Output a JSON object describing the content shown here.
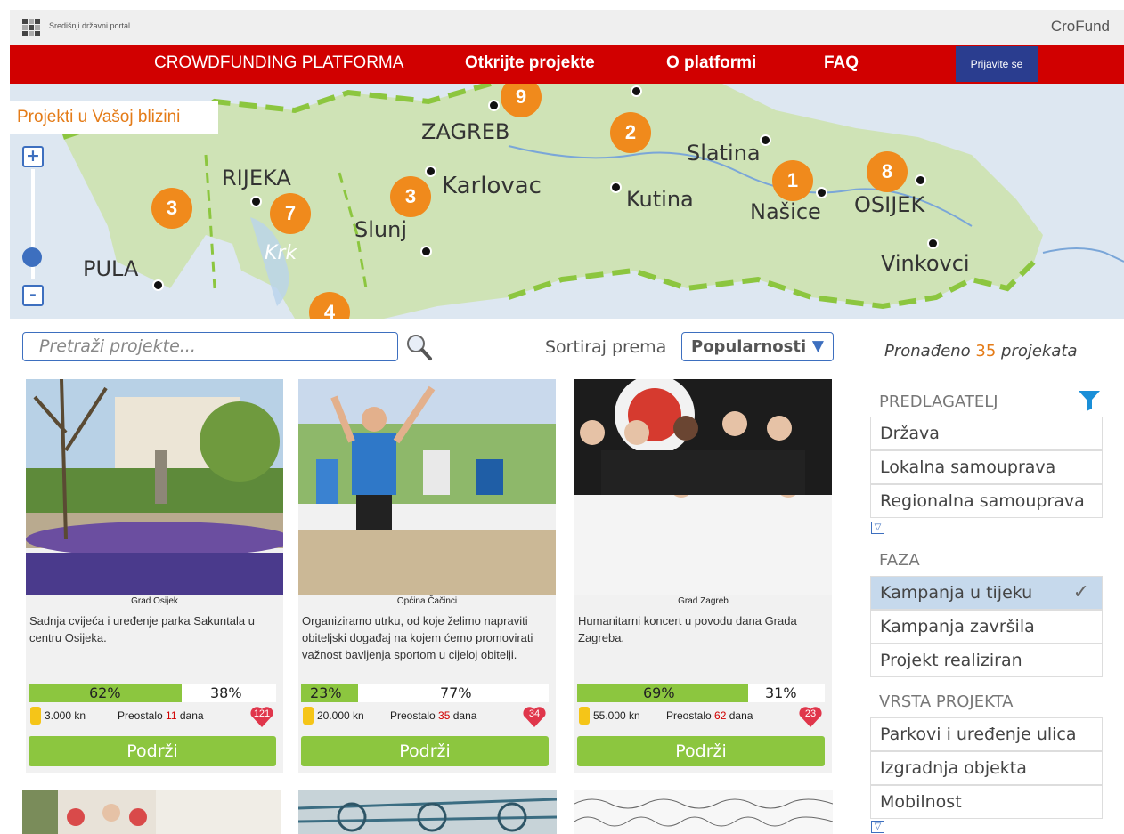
{
  "header": {
    "gov_portal": "Središnji državni portal",
    "brand": "CroFund"
  },
  "nav": {
    "platform": "CROWDFUNDING PLATFORMA",
    "discover": "Otkrijte projekte",
    "about": "O platformi",
    "faq": "FAQ",
    "login": "Prijavite se"
  },
  "map": {
    "title": "Projekti u Vašoj blizini",
    "zoom_in": "+",
    "zoom_out": "-",
    "zoom_level_fraction": 0.65,
    "cities": [
      "ZAGREB",
      "Karlovac",
      "Kutina",
      "Slatina",
      "Našice",
      "OSIJEK",
      "RIJEKA",
      "Slunj",
      "Vinkovci",
      "PULA",
      "Krk"
    ],
    "markers": [
      "9",
      "2",
      "1",
      "8",
      "3",
      "7",
      "3",
      "4"
    ]
  },
  "search": {
    "placeholder": "Pretraži projekte...",
    "sort_label": "Sortiraj prema",
    "sort_value": "Popularnosti"
  },
  "cards": [
    {
      "org": "Grad Osijek",
      "desc": "Sadnja cvijeća i uređenje parka Sakuntala u centru Osijeka.",
      "funded_pct": "62%",
      "remaining_pct": "38%",
      "funded_fraction": 0.62,
      "goal": "3.000 kn",
      "remain_prefix": "Preostalo",
      "days": "11",
      "remain_suffix": "dana",
      "likes": "121",
      "button": "Podrži"
    },
    {
      "org": "Općina Čačinci",
      "desc": "Organiziramo utrku, od koje želimo napraviti obiteljski događaj na kojem ćemo promovirati važnost bavljenja sportom u cijeloj obitelji.",
      "funded_pct": "23%",
      "remaining_pct": "77%",
      "funded_fraction": 0.23,
      "goal": "20.000 kn",
      "remain_prefix": "Preostalo",
      "days": "35",
      "remain_suffix": "dana",
      "likes": "34",
      "button": "Podrži"
    },
    {
      "org": "Grad Zagreb",
      "desc": "Humanitarni koncert u povodu dana Grada Zagreba.",
      "funded_pct": "69%",
      "remaining_pct": "31%",
      "funded_fraction": 0.69,
      "goal": "55.000 kn",
      "remain_prefix": "Preostalo",
      "days": "62",
      "remain_suffix": "dana",
      "likes": "23",
      "button": "Podrži"
    }
  ],
  "results": {
    "prefix": "Pronađeno",
    "count": "35",
    "suffix": "projekata"
  },
  "filters": {
    "proposer": {
      "title": "PREDLAGATELJ",
      "items": [
        "Država",
        "Lokalna samouprava",
        "Regionalna samouprava"
      ]
    },
    "phase": {
      "title": "FAZA",
      "items": [
        "Kampanja u tijeku",
        "Kampanja završila",
        "Projekt realiziran"
      ],
      "selected": "Kampanja u tijeku"
    },
    "type": {
      "title": "VRSTA PROJEKTA",
      "items": [
        "Parkovi i uređenje ulica",
        "Izgradnja objekta",
        "Mobilnost"
      ]
    }
  },
  "colors": {
    "nav_red": "#d10000",
    "login_blue": "#2a3d8f",
    "accent_orange": "#f08a1c",
    "progress_green": "#8cc63f",
    "link_blue": "#3d6fbf"
  }
}
